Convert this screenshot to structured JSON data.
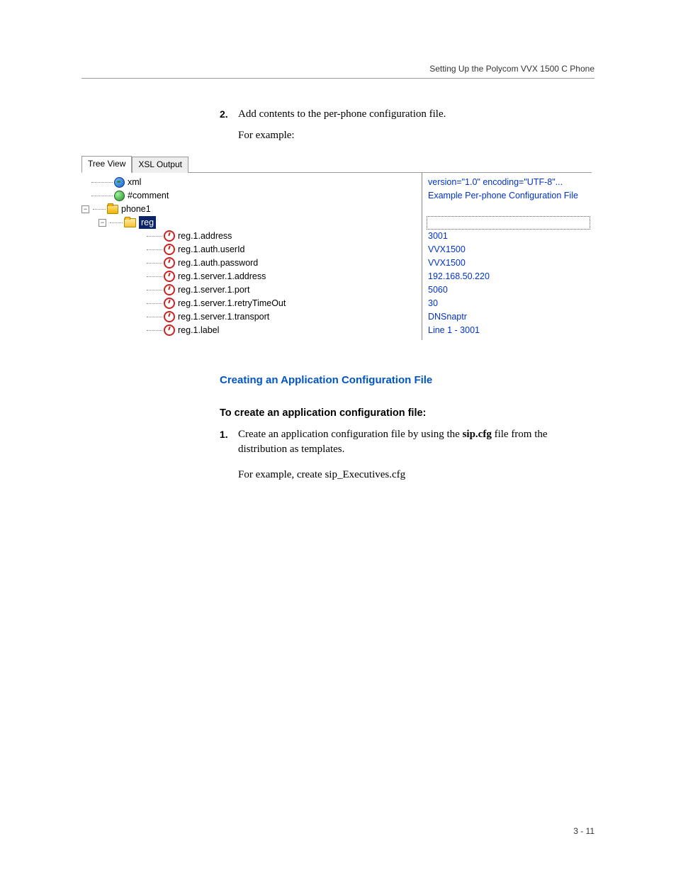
{
  "header": "Setting Up the Polycom VVX 1500 C Phone",
  "step2": {
    "num": "2.",
    "text": "Add contents to the per-phone configuration file.",
    "cont": "For example:"
  },
  "tabs": {
    "active": "Tree View",
    "inactive": "XSL Output"
  },
  "tree": {
    "xml": {
      "label": "xml",
      "value": "version=\"1.0\" encoding=\"UTF-8\"..."
    },
    "comment": {
      "label": "#comment",
      "value": "Example Per-phone Configuration File"
    },
    "phone1": {
      "label": "phone1"
    },
    "reg": {
      "label": "reg"
    },
    "attrs": [
      {
        "label": "reg.1.address",
        "value": "3001"
      },
      {
        "label": "reg.1.auth.userId",
        "value": "VVX1500"
      },
      {
        "label": "reg.1.auth.password",
        "value": "VVX1500"
      },
      {
        "label": "reg.1.server.1.address",
        "value": "192.168.50.220"
      },
      {
        "label": "reg.1.server.1.port",
        "value": "5060"
      },
      {
        "label": "reg.1.server.1.retryTimeOut",
        "value": "30"
      },
      {
        "label": "reg.1.server.1.transport",
        "value": "DNSnaptr"
      },
      {
        "label": "reg.1.label",
        "value": "Line 1 - 3001"
      }
    ]
  },
  "sectionHeading": "Creating an Application Configuration File",
  "subHeading": "To create an application configuration file:",
  "step1b": {
    "num": "1.",
    "text_a": "Create an application configuration file by using the ",
    "bold": "sip.cfg",
    "text_b": " file from the distribution as templates.",
    "cont": "For example, create sip_Executives.cfg"
  },
  "pageNum": "3 - 11"
}
